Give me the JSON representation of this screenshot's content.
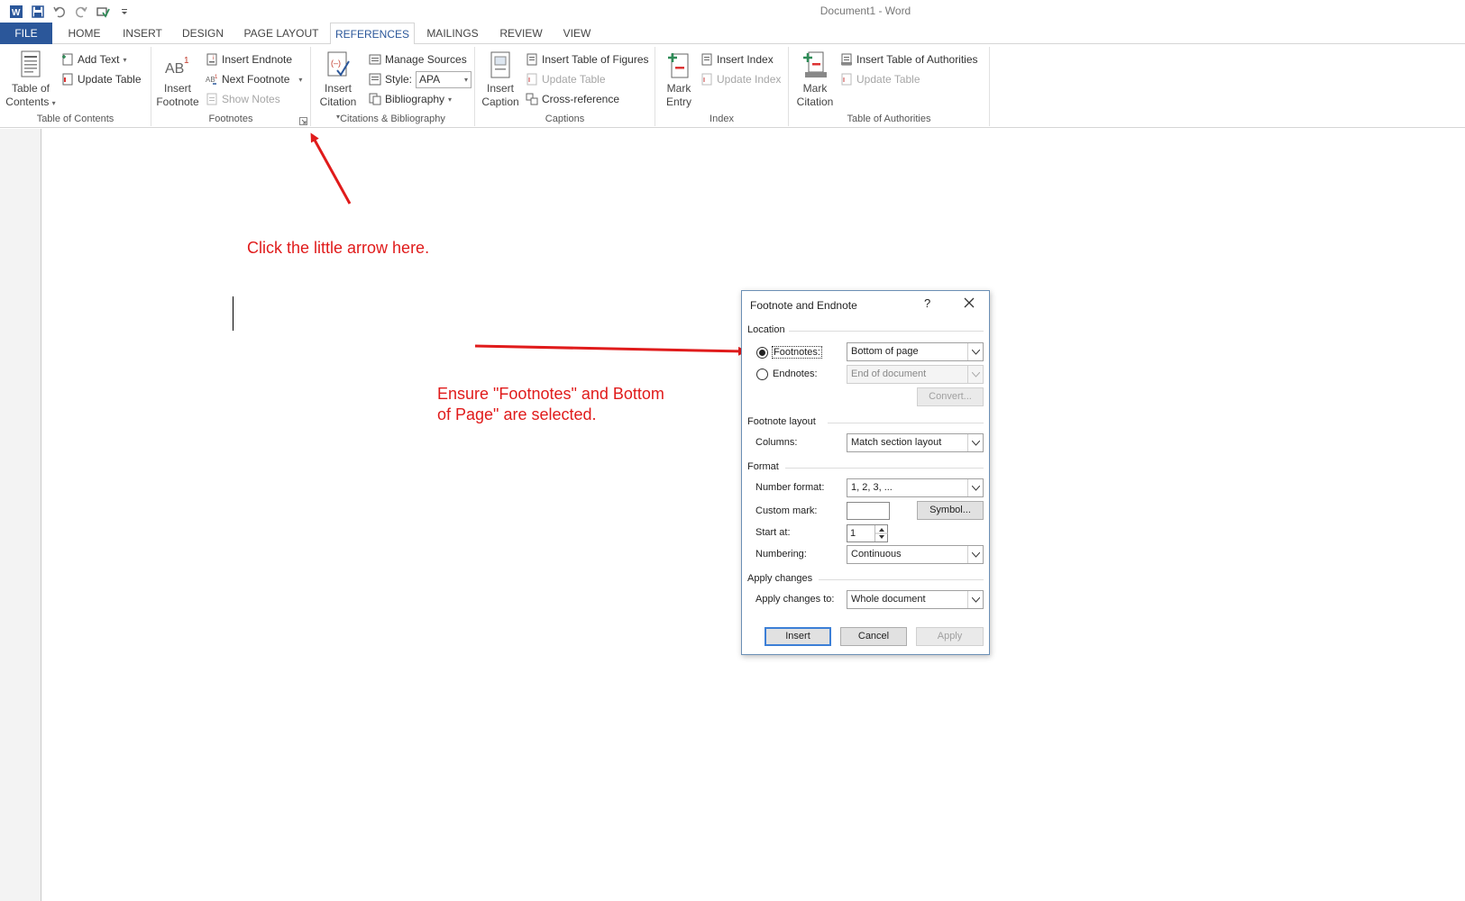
{
  "window": {
    "title": "Document1 - Word"
  },
  "colors": {
    "file_tab": "#2b579a",
    "accent": "#2b579a",
    "annotation": "#e01b1b"
  },
  "qat": {
    "icons": [
      "word-logo-icon",
      "save-icon",
      "undo-icon",
      "redo-icon",
      "touch-mode-icon",
      "customize-qat-icon"
    ]
  },
  "tabs": [
    "FILE",
    "HOME",
    "INSERT",
    "DESIGN",
    "PAGE LAYOUT",
    "REFERENCES",
    "MAILINGS",
    "REVIEW",
    "VIEW"
  ],
  "active_tab": "REFERENCES",
  "ribbon": {
    "toc": {
      "label": "Table of Contents",
      "big_line1": "Table of",
      "big_line2": "Contents",
      "add_text": "Add Text",
      "update_table": "Update Table"
    },
    "footnotes": {
      "label": "Footnotes",
      "insert_line1": "Insert",
      "insert_line2": "Footnote",
      "insert_endnote": "Insert Endnote",
      "next_footnote": "Next Footnote",
      "show_notes": "Show Notes"
    },
    "citations": {
      "label": "Citations & Bibliography",
      "insert_line1": "Insert",
      "insert_line2": "Citation",
      "manage_sources": "Manage Sources",
      "style_label": "Style:",
      "style_value": "APA",
      "bibliography": "Bibliography"
    },
    "captions": {
      "label": "Captions",
      "insert_line1": "Insert",
      "insert_line2": "Caption",
      "insert_tof": "Insert Table of Figures",
      "update_table": "Update Table",
      "cross_reference": "Cross-reference"
    },
    "index": {
      "label": "Index",
      "mark_line1": "Mark",
      "mark_line2": "Entry",
      "insert_index": "Insert Index",
      "update_index": "Update Index"
    },
    "authorities": {
      "label": "Table of Authorities",
      "mark_line1": "Mark",
      "mark_line2": "Citation",
      "insert_toa": "Insert Table of Authorities",
      "update_table": "Update Table"
    }
  },
  "annotations": {
    "arrow_note": "Click the little arrow here.",
    "ensure_line1": "Ensure \"Footnotes\" and Bottom",
    "ensure_line2": "of Page\" are selected."
  },
  "dialog": {
    "title": "Footnote and Endnote",
    "help": "?",
    "location_header": "Location",
    "footnotes_label": "Footnotes:",
    "footnotes_value": "Bottom of page",
    "endnotes_label": "Endnotes:",
    "endnotes_value": "End of document",
    "convert": "Convert...",
    "layout_header": "Footnote layout",
    "columns_label": "Columns:",
    "columns_value": "Match section layout",
    "format_header": "Format",
    "number_format_label": "Number format:",
    "number_format_value": "1, 2, 3, ...",
    "custom_mark_label": "Custom mark:",
    "custom_mark_value": "",
    "symbol": "Symbol...",
    "start_at_label": "Start at:",
    "start_at_value": "1",
    "numbering_label": "Numbering:",
    "numbering_value": "Continuous",
    "apply_header": "Apply changes",
    "apply_to_label": "Apply changes to:",
    "apply_to_value": "Whole document",
    "insert": "Insert",
    "cancel": "Cancel",
    "apply": "Apply"
  }
}
